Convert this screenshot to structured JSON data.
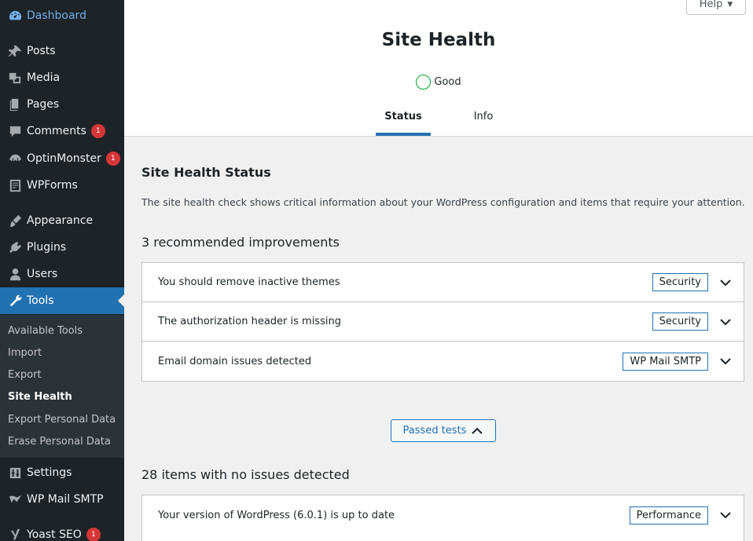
{
  "sidebar": {
    "items": [
      {
        "label": "Dashboard",
        "icon": "dashboard-icon"
      },
      {
        "label": "Posts",
        "icon": "pin-icon"
      },
      {
        "label": "Media",
        "icon": "media-icon"
      },
      {
        "label": "Pages",
        "icon": "pages-icon"
      },
      {
        "label": "Comments",
        "icon": "comment-icon",
        "badge": "1"
      },
      {
        "label": "OptinMonster",
        "icon": "optinmonster-icon",
        "badge": "1"
      },
      {
        "label": "WPForms",
        "icon": "forms-icon"
      },
      {
        "label": "Appearance",
        "icon": "brush-icon"
      },
      {
        "label": "Plugins",
        "icon": "plugin-icon"
      },
      {
        "label": "Users",
        "icon": "user-icon"
      },
      {
        "label": "Tools",
        "icon": "wrench-icon"
      },
      {
        "label": "Settings",
        "icon": "settings-icon"
      },
      {
        "label": "WP Mail SMTP",
        "icon": "mail-icon"
      },
      {
        "label": "Yoast SEO",
        "icon": "yoast-icon",
        "badge": "1"
      }
    ],
    "submenu": [
      {
        "label": "Available Tools"
      },
      {
        "label": "Import"
      },
      {
        "label": "Export"
      },
      {
        "label": "Site Health"
      },
      {
        "label": "Export Personal Data"
      },
      {
        "label": "Erase Personal Data"
      }
    ]
  },
  "header": {
    "help_label": "Help",
    "title": "Site Health",
    "status": "Good",
    "tabs": [
      {
        "label": "Status"
      },
      {
        "label": "Info"
      }
    ]
  },
  "main": {
    "section_title": "Site Health Status",
    "description": "The site health check shows critical information about your WordPress configuration and items that require your attention.",
    "recommended_title": "3 recommended improvements",
    "recommended": [
      {
        "label": "You should remove inactive themes",
        "badge": "Security"
      },
      {
        "label": "The authorization header is missing",
        "badge": "Security"
      },
      {
        "label": "Email domain issues detected",
        "badge": "WP Mail SMTP"
      }
    ],
    "passed_button": "Passed tests",
    "passed_title": "28 items with no issues detected",
    "passed": [
      {
        "label": "Your version of WordPress (6.0.1) is up to date",
        "badge": "Performance"
      }
    ]
  },
  "colors": {
    "sidebar_bg": "#1d2327",
    "accent": "#2271b1",
    "badge": "#d63638",
    "good": "#00a32a"
  }
}
